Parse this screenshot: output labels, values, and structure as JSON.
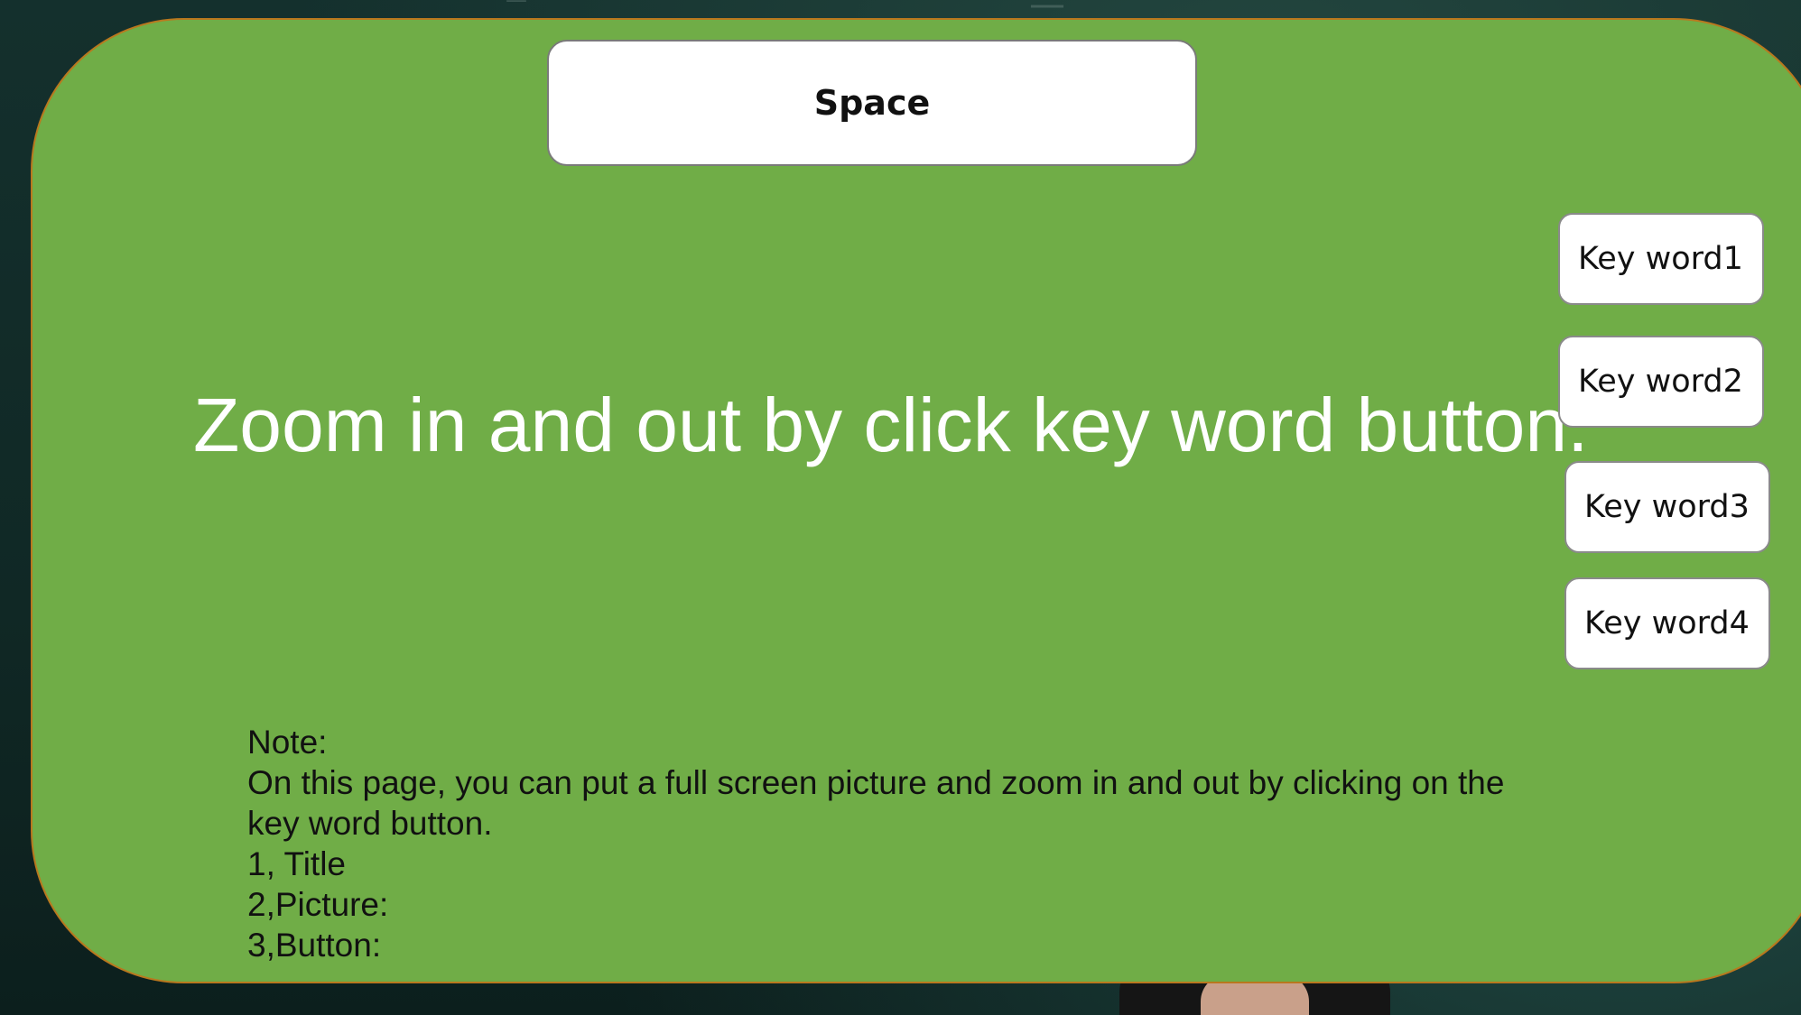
{
  "slide": {
    "space_button_label": "Space",
    "headline": "Zoom in and out by click key word button.",
    "keyword_buttons": [
      {
        "label": "Key word1"
      },
      {
        "label": "Key word2"
      },
      {
        "label": "Key word3"
      },
      {
        "label": "Key word4"
      }
    ],
    "note": {
      "heading": "Note:",
      "line1": "On this page, you can put a full screen picture and zoom in and out by clicking on the",
      "line2": "key word button.",
      "item1": "1, Title",
      "item2": "2,Picture:",
      "item3": "3,Button:"
    }
  },
  "colors": {
    "panel_fill": "#70ad47",
    "panel_border": "#b9781e",
    "button_fill": "#ffffff",
    "headline_text": "#ffffff",
    "background": "#0f2826"
  }
}
